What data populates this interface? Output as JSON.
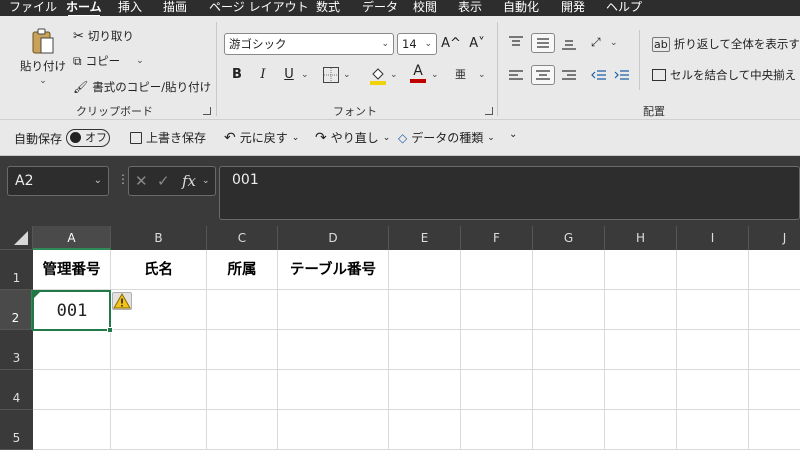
{
  "menu": {
    "tabs": [
      {
        "label": "ファイル",
        "active": false
      },
      {
        "label": "ホーム",
        "active": true
      },
      {
        "label": "挿入",
        "active": false
      },
      {
        "label": "描画",
        "active": false
      },
      {
        "label": "ページ レイアウト",
        "active": false
      },
      {
        "label": "数式",
        "active": false
      },
      {
        "label": "データ",
        "active": false
      },
      {
        "label": "校閲",
        "active": false
      },
      {
        "label": "表示",
        "active": false
      },
      {
        "label": "自動化",
        "active": false
      },
      {
        "label": "開発",
        "active": false
      },
      {
        "label": "ヘルプ",
        "active": false
      }
    ]
  },
  "ribbon": {
    "clipboard": {
      "paste": "貼り付け",
      "cut": "切り取り",
      "copy": "コピー",
      "format_painter": "書式のコピー/貼り付け",
      "label": "クリップボード"
    },
    "font": {
      "name": "游ゴシック",
      "size": "14",
      "grow": "A^",
      "shrink": "A˅",
      "bold": "B",
      "italic": "I",
      "underline": "U",
      "fill_color": "#f2d20a",
      "font_color": "#c00000",
      "font_letter": "A",
      "phonetic": "亜",
      "label": "フォント"
    },
    "alignment": {
      "wrap": "折り返して全体を表示する",
      "merge": "セルを結合して中央揃え",
      "label": "配置"
    }
  },
  "qat": {
    "autosave": "自動保存",
    "autosave_state": "オフ",
    "save": "上書き保存",
    "undo": "元に戻す",
    "redo": "やり直し",
    "data_type": "データの種類"
  },
  "formula_bar": {
    "name_box": "A2",
    "fx": "fx",
    "content": "001"
  },
  "sheet": {
    "columns": [
      "A",
      "B",
      "C",
      "D",
      "E",
      "F",
      "G",
      "H",
      "I",
      "J"
    ],
    "active_column": "A",
    "rows": [
      "1",
      "2",
      "3",
      "4",
      "5"
    ],
    "active_row": "2",
    "header_cells": [
      "管理番号",
      "氏名",
      "所属",
      "テーブル番号"
    ],
    "active_cell_value": "001"
  }
}
